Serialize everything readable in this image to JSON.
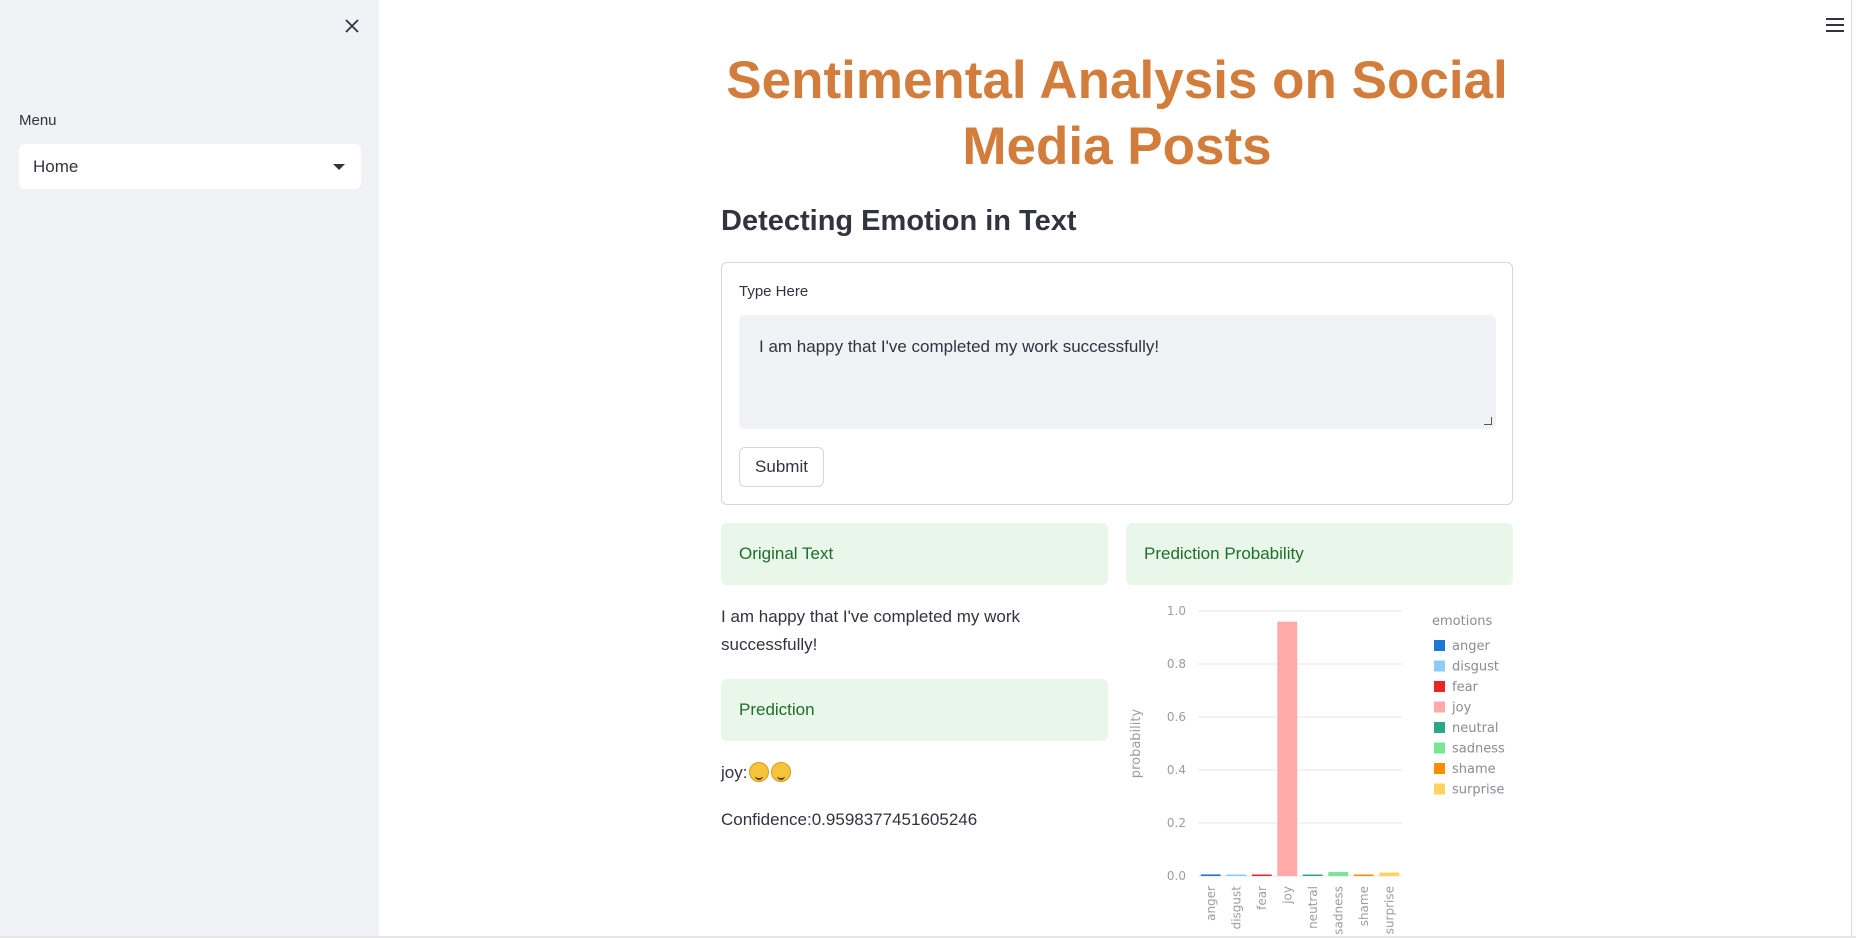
{
  "sidebar": {
    "close_icon": "close-icon",
    "menu_label": "Menu",
    "menu_selected": "Home"
  },
  "header": {
    "menu_icon": "hamburger-icon"
  },
  "main": {
    "title": "Sentimental Analysis on Social Media Posts",
    "subheader": "Detecting Emotion in Text",
    "form": {
      "label": "Type Here",
      "text_value": "I am happy that I've completed my work successfully!",
      "submit_label": "Submit"
    },
    "original_text_header": "Original Text",
    "original_text": "I am happy that I've completed my work successfully!",
    "prediction_header": "Prediction",
    "prediction_label": "joy:",
    "prediction_emoji": [
      "smiling-face-icon",
      "hugging-face-icon"
    ],
    "confidence_text": "Confidence:0.9598377451605246",
    "probability_header": "Prediction Probability"
  },
  "colors": {
    "title": "#d27d3b",
    "info_bg": "#e8f7ea",
    "info_text": "#1f6e2a",
    "sidebar_bg": "#f0f2f6"
  },
  "chart_data": {
    "type": "bar",
    "categories": [
      "anger",
      "disgust",
      "fear",
      "joy",
      "neutral",
      "sadness",
      "shame",
      "surprise"
    ],
    "values": [
      0.006,
      0.003,
      0.002,
      0.96,
      0.003,
      0.015,
      0.001,
      0.013
    ],
    "colors": [
      "#1f77d4",
      "#8ecbf5",
      "#e8262a",
      "#ffa9a9",
      "#2ca58d",
      "#7be495",
      "#ff8c00",
      "#ffd35c"
    ],
    "ylabel": "probability",
    "xlabel": "",
    "legend_title": "emotions",
    "legend_position": "right",
    "yticks": [
      "0.0",
      "0.2",
      "0.4",
      "0.6",
      "0.8",
      "1.0"
    ],
    "ylim": [
      0,
      1
    ],
    "grid": true
  }
}
